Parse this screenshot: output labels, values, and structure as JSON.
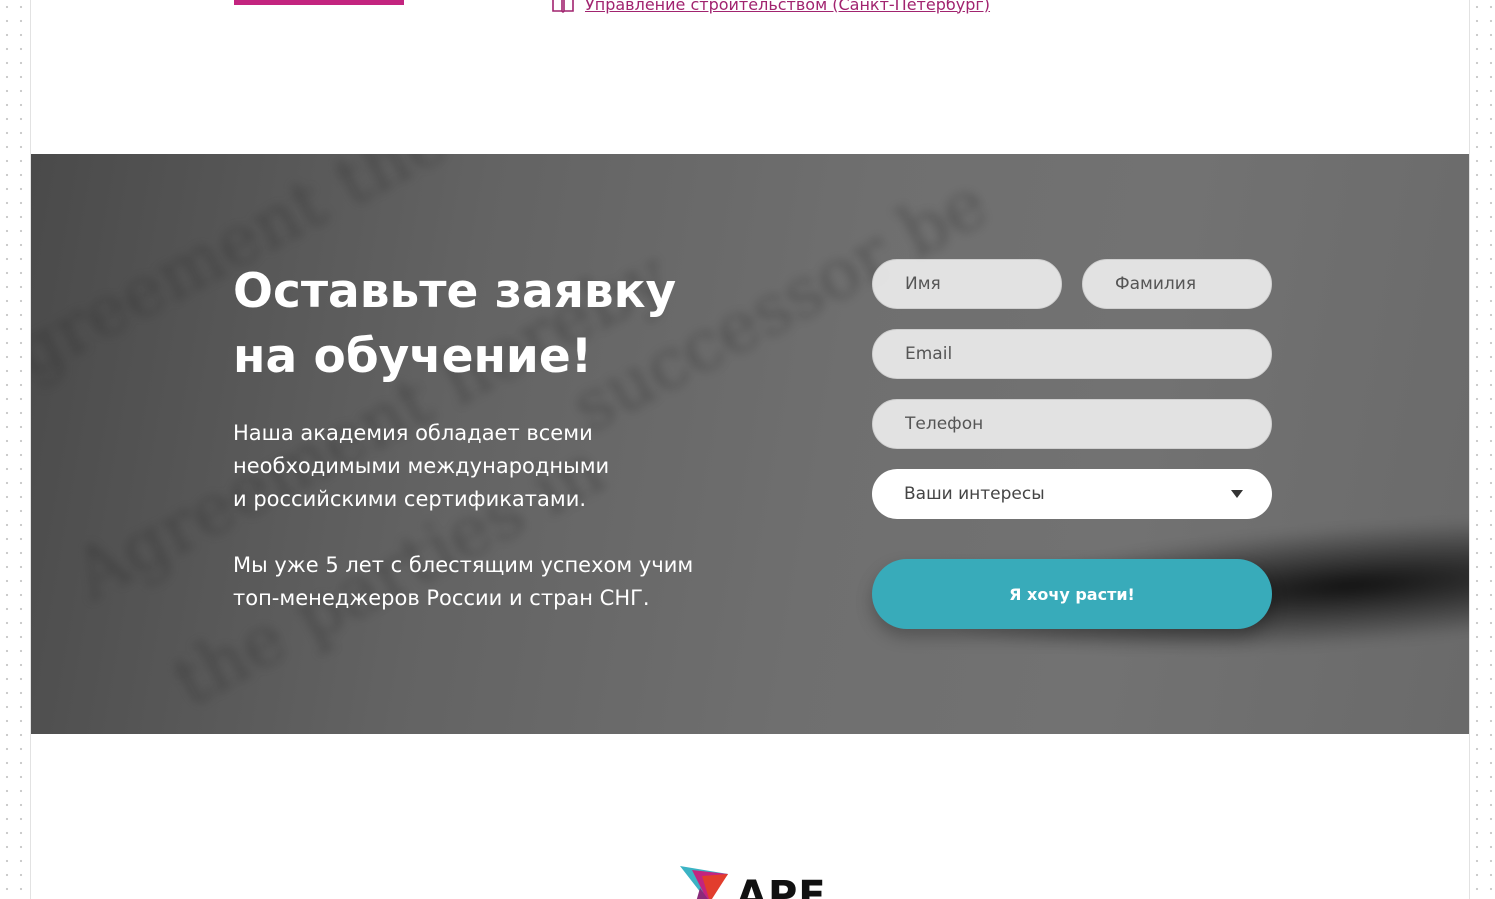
{
  "top": {
    "course_link": "Управление строительством (Санкт-Петербург)"
  },
  "hero": {
    "heading_line1": "Оставьте заявку",
    "heading_line2": "на обучение!",
    "para1": [
      "Наша академия обладает всеми",
      "необходимыми международными",
      "и российскими сертификатами."
    ],
    "para2": [
      "Мы уже 5 лет с блестящим успехом учим",
      "топ-менеджеров России и стран СНГ."
    ]
  },
  "form": {
    "first_name_placeholder": "Имя",
    "last_name_placeholder": "Фамилия",
    "email_placeholder": "Email",
    "phone_placeholder": "Телефон",
    "interests_label": "Ваши интересы",
    "submit_label": "Я хочу расти!"
  },
  "footer": {
    "logo_text": "APE"
  },
  "colors": {
    "accent_magenta": "#c3247f",
    "link_color": "#a1236f",
    "button_teal": "#38abba"
  },
  "icons": {
    "course_link": "book-icon",
    "select": "caret-down-icon"
  }
}
